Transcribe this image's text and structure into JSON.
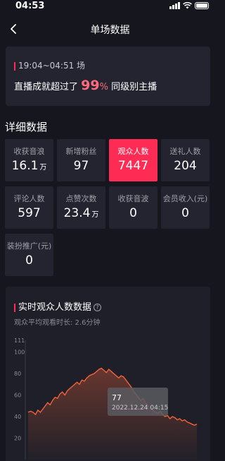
{
  "status": {
    "time": "04:53"
  },
  "header": {
    "title": "单场数据"
  },
  "summary": {
    "time_range": "19:04~04:51 场",
    "beat_prefix": "直播成就超过了",
    "beat_number": "99",
    "beat_percent": "%",
    "beat_suffix": "同级别主播"
  },
  "details": {
    "title": "详细数据",
    "stats": [
      {
        "label": "收获音浪",
        "value": "16.1",
        "unit": "万"
      },
      {
        "label": "新增粉丝",
        "value": "97",
        "unit": ""
      },
      {
        "label": "观众人数",
        "value": "7447",
        "unit": "",
        "active": true
      },
      {
        "label": "送礼人数",
        "value": "204",
        "unit": ""
      },
      {
        "label": "评论人数",
        "value": "597",
        "unit": ""
      },
      {
        "label": "点赞次数",
        "value": "23.4",
        "unit": "万"
      },
      {
        "label": "收获音波",
        "value": "0",
        "unit": ""
      },
      {
        "label": "会员收入(元)",
        "value": "0",
        "unit": ""
      },
      {
        "label": "装扮推广(元)",
        "value": "0",
        "unit": ""
      }
    ]
  },
  "realtime": {
    "title": "实时观众人数数据",
    "subtitle": "观众平均观看时长: 2.6分钟",
    "tooltip_value": "77",
    "tooltip_time": "2022.12.24 04:15"
  },
  "colors": {
    "accent": "#fe2c55",
    "line": "#f0623a"
  },
  "chart_data": {
    "type": "line",
    "y_ticks": [
      "111",
      "100",
      "80",
      "60",
      "40",
      "20"
    ],
    "ylim": [
      0,
      111
    ],
    "values": [
      44,
      45,
      44,
      42,
      46,
      44,
      47,
      50,
      53,
      51,
      55,
      58,
      57,
      61,
      63,
      60,
      64,
      66,
      68,
      70,
      72,
      70,
      74,
      73,
      76,
      78,
      79,
      80,
      82,
      84,
      85,
      83,
      81,
      84,
      82,
      80,
      78,
      76,
      78,
      77,
      74,
      71,
      68,
      64,
      61,
      58,
      55,
      57,
      53,
      50,
      48,
      46,
      44,
      43,
      45,
      42,
      40,
      41,
      38,
      40,
      39,
      37,
      38,
      36,
      37,
      35,
      34,
      33,
      32,
      33
    ]
  }
}
